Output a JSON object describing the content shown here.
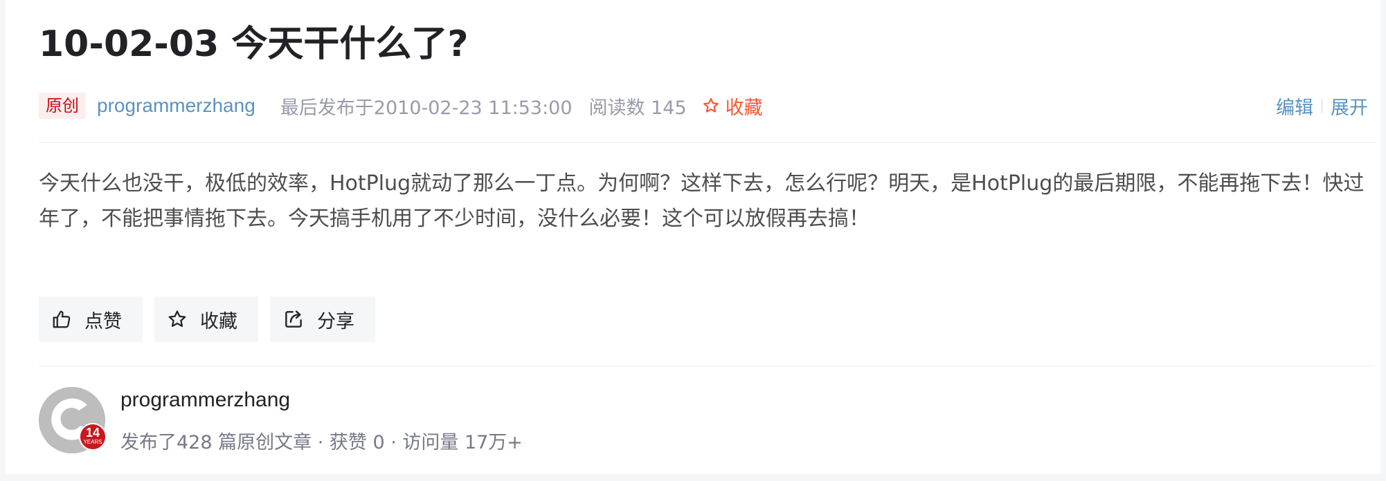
{
  "article": {
    "title": "10-02-03 今天干什么了?",
    "badge": "原创",
    "author": "programmerzhang",
    "published": "最后发布于2010-02-23 11:53:00",
    "read_count": "阅读数 145",
    "favorite": "收藏",
    "edit": "编辑",
    "expand": "展开",
    "body": "今天什么也没干，极低的效率，HotPlug就动了那么一丁点。为何啊？这样下去，怎么行呢？明天，是HotPlug的最后期限，不能再拖下去！快过年了，不能把事情拖下去。今天搞手机用了不少时间，没什么必要！这个可以放假再去搞！"
  },
  "actions": {
    "like": "点赞",
    "favorite": "收藏",
    "share": "分享"
  },
  "profile": {
    "name": "programmerzhang",
    "years_number": "14",
    "years_label": "YEARS",
    "stats": "发布了428 篇原创文章 · 获赞 0 · 访问量 17万+"
  },
  "colors": {
    "badge_text": "#ca0c16",
    "author_link": "#5893c2",
    "favorite_accent": "#fc5531",
    "years_badge": "#c8181e"
  },
  "icons": {
    "favorite_meta": "star-outline-icon",
    "like": "thumbs-up-icon",
    "favorite": "star-outline-icon",
    "share": "share-icon"
  }
}
